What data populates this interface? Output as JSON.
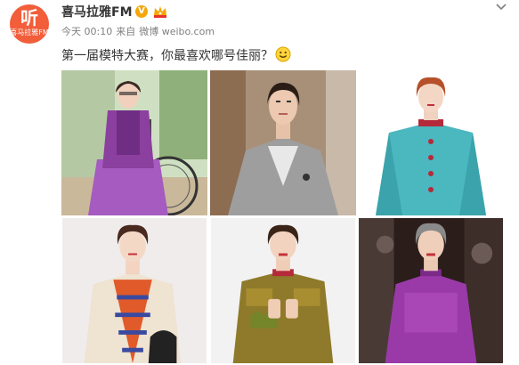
{
  "account": {
    "avatar_glyph": "听",
    "avatar_brand": "喜马拉雅FM",
    "username": "喜马拉雅FM",
    "verified_badge": "V",
    "verified_icon": "verified-v-icon",
    "member_icon": "crown-icon"
  },
  "post": {
    "time": "今天 00:10",
    "source_prefix": "来自",
    "source": "微博 weibo.com",
    "text": "第一届模特大赛，你最喜欢哪号佳丽？",
    "emoji": "smiley-icon"
  },
  "photos": [
    {
      "name": "photo-1",
      "description_icon": "woman-in-wheelchair-purple"
    },
    {
      "name": "photo-2",
      "description_icon": "woman-grey-blazer"
    },
    {
      "name": "photo-3",
      "description_icon": "woman-teal-jacket"
    },
    {
      "name": "photo-4",
      "description_icon": "woman-cream-blazer"
    },
    {
      "name": "photo-5",
      "description_icon": "woman-gold-jacket"
    },
    {
      "name": "photo-6",
      "description_icon": "woman-purple-dress"
    }
  ],
  "colors": {
    "accent": "#f25d3a",
    "verified": "#f4a70a",
    "meta_text": "#808080"
  }
}
